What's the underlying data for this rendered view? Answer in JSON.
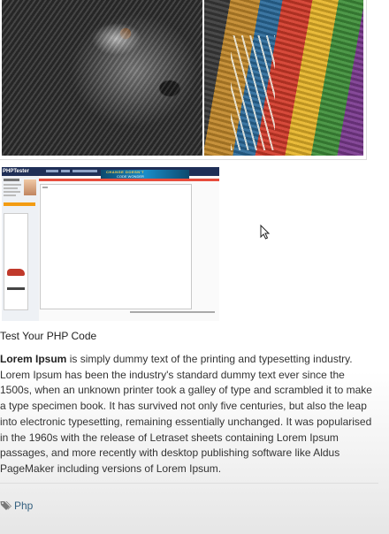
{
  "screenshot": {
    "brand": "PHPTester",
    "ad_headline": "CHANGE DOESN'T",
    "ad_subline": "CODE WONDER"
  },
  "post": {
    "caption": "Test Your PHP Code",
    "body_bold": "Lorem Ipsum",
    "body_text": " is simply dummy text of the printing and typesetting industry. Lorem Ipsum has been the industry's standard dummy text ever since the 1500s, when an unknown printer took a galley of type and scrambled it to make a type specimen book. It has survived not only five centuries, but also the leap into electronic typesetting, remaining essentially unchanged. It was popularised in the 1960s with the release of Letraset sheets containing Lorem Ipsum passages, and more recently with desktop publishing software like Aldus PageMaker including versions of Lorem Ipsum."
  },
  "tags": {
    "icon": "tag-icon",
    "items": [
      "Php"
    ]
  },
  "colors": {
    "link": "#34607f",
    "text": "#333333",
    "site_nav": "#1f2f57",
    "accent_red": "#e74c3c",
    "accent_orange": "#f39c12"
  }
}
